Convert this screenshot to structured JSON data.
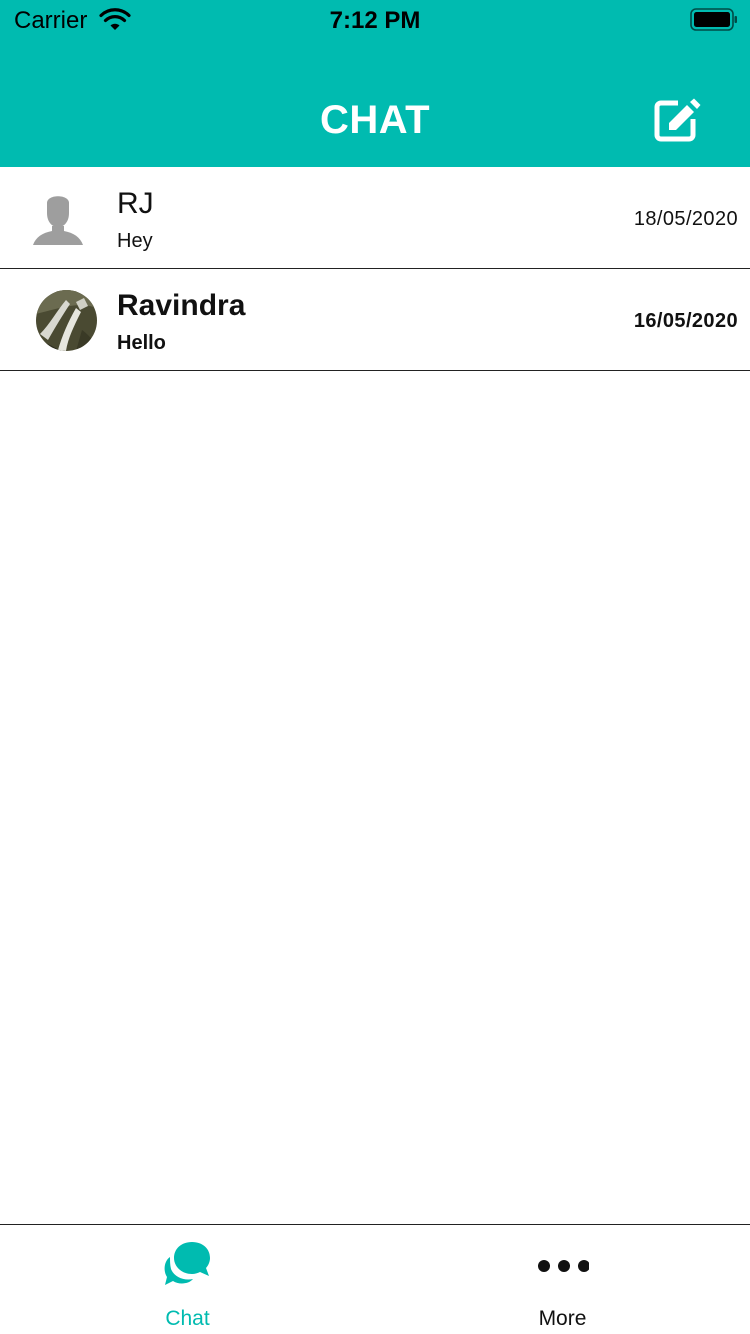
{
  "status_bar": {
    "carrier": "Carrier",
    "time": "7:12 PM"
  },
  "header": {
    "title": "CHAT",
    "compose_icon": "compose-icon"
  },
  "colors": {
    "accent": "#00BBB0",
    "text": "#111111",
    "divider": "#222222"
  },
  "conversations": [
    {
      "name": "RJ",
      "message": "Hey",
      "date": "18/05/2020",
      "avatar": "default-avatar-icon",
      "unread": false
    },
    {
      "name": "Ravindra",
      "message": "Hello",
      "date": "16/05/2020",
      "avatar": "photo",
      "unread": true
    }
  ],
  "tabbar": {
    "tabs": [
      {
        "label": "Chat",
        "icon": "chat-bubbles-icon",
        "active": true
      },
      {
        "label": "More",
        "icon": "more-dots-icon",
        "active": false
      }
    ]
  }
}
